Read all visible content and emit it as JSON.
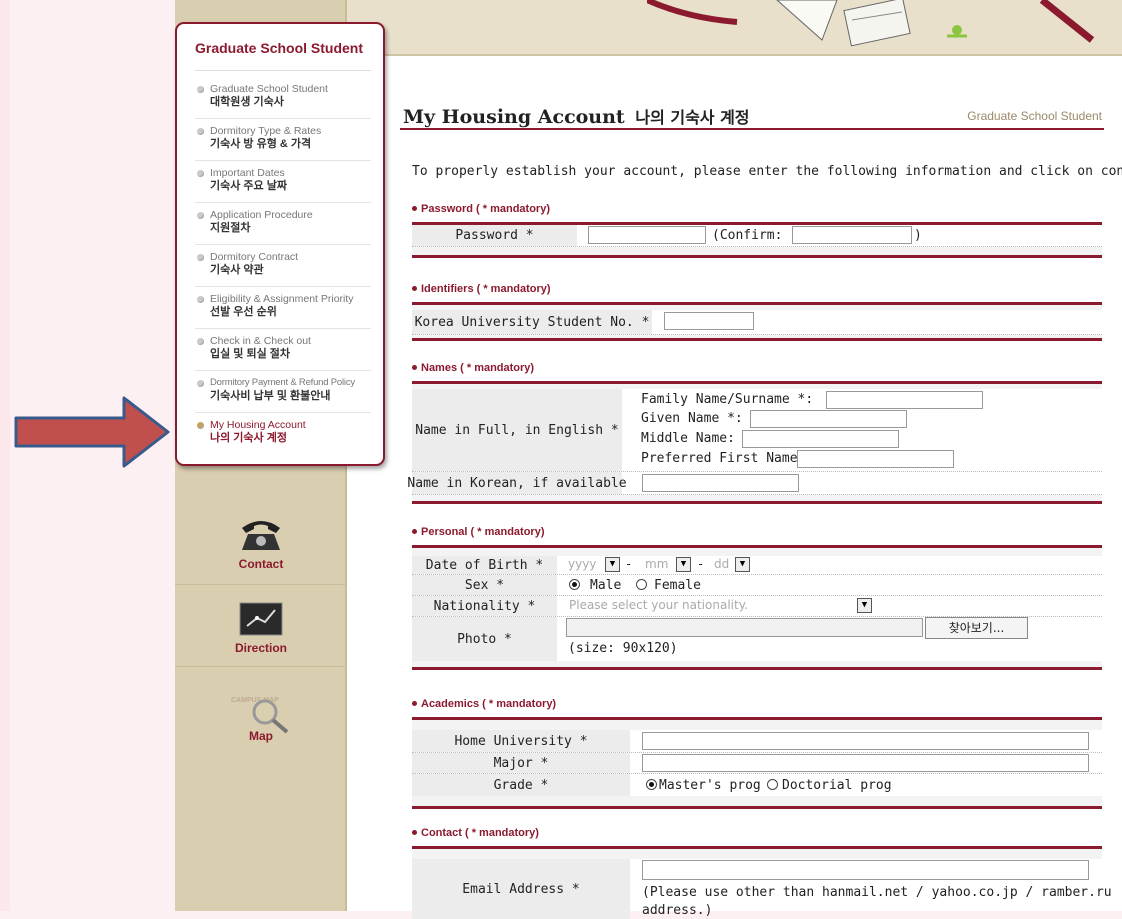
{
  "sidebar": {
    "title": "Graduate School Student",
    "items": [
      {
        "en": "Graduate School Student",
        "ko": "대학원생 기숙사"
      },
      {
        "en": "Dormitory Type & Rates",
        "ko": "기숙사 방 유형 & 가격"
      },
      {
        "en": "Important Dates",
        "ko": "기숙사 주요 날짜"
      },
      {
        "en": "Application Procedure",
        "ko": "지원절차"
      },
      {
        "en": "Dormitory Contract",
        "ko": "기숙사 약관"
      },
      {
        "en": "Eligibility & Assignment Priority",
        "ko": "선발 우선 순위"
      },
      {
        "en": "Check in & Check out",
        "ko": "입실 및 퇴실 절차"
      },
      {
        "en": "Dormitory Payment & Refund Policy",
        "ko": "기숙사비 납부 및 환불안내"
      },
      {
        "en": "My Housing Account",
        "ko": "나의 기숙사 계정"
      }
    ]
  },
  "quick_links": {
    "contact": "Contact",
    "direction": "Direction",
    "map": "Map",
    "map_badge": "CAMPUS MAP"
  },
  "page": {
    "title": "My Housing Account",
    "title_ko": "나의 기숙사 계정",
    "section_label": "Graduate School Student",
    "intro": "To properly establish your account, please enter the following information and click on continue."
  },
  "sections": {
    "password": {
      "header": "Password ( * mandatory)",
      "label": "Password *",
      "confirm_open": "(Confirm:",
      "confirm_close": ")"
    },
    "identifiers": {
      "header": "Identifiers ( * mandatory)",
      "label": "Korea University Student No. *"
    },
    "names": {
      "header": "Names ( * mandatory)",
      "full_label": "Name in Full, in English *",
      "family": "Family Name/Surname *:",
      "given": "Given Name *:",
      "middle": "Middle Name:",
      "preferred": "Preferred First Name:",
      "korean_label": "Name in Korean, if available"
    },
    "personal": {
      "header": "Personal ( * mandatory)",
      "dob_label": "Date of Birth *",
      "yyyy": "yyyy",
      "mm": "mm",
      "dd": "dd",
      "dash": "-",
      "sex_label": "Sex *",
      "male": "Male",
      "female": "Female",
      "nationality_label": "Nationality *",
      "nationality_placeholder": "Please select your nationality.",
      "photo_label": "Photo *",
      "browse": "찾아보기...",
      "photo_size": "(size: 90x120)"
    },
    "academics": {
      "header": "Academics ( * mandatory)",
      "home_label": "Home University *",
      "major_label": "Major *",
      "grade_label": "Grade *",
      "masters": "Master's prog",
      "doctoral": "Doctorial prog"
    },
    "contact": {
      "header": "Contact ( * mandatory)",
      "email_label": "Email Address *",
      "email_note": "(Please use other than hanmail.net / yahoo.co.jp / ramber.ru",
      "email_note2": "address.)"
    }
  },
  "colors": {
    "brand": "#8b1a2e",
    "sidebar_bg": "#d9ceb0",
    "arrow": "#c0504d",
    "arrow_border": "#3a5a8c"
  }
}
